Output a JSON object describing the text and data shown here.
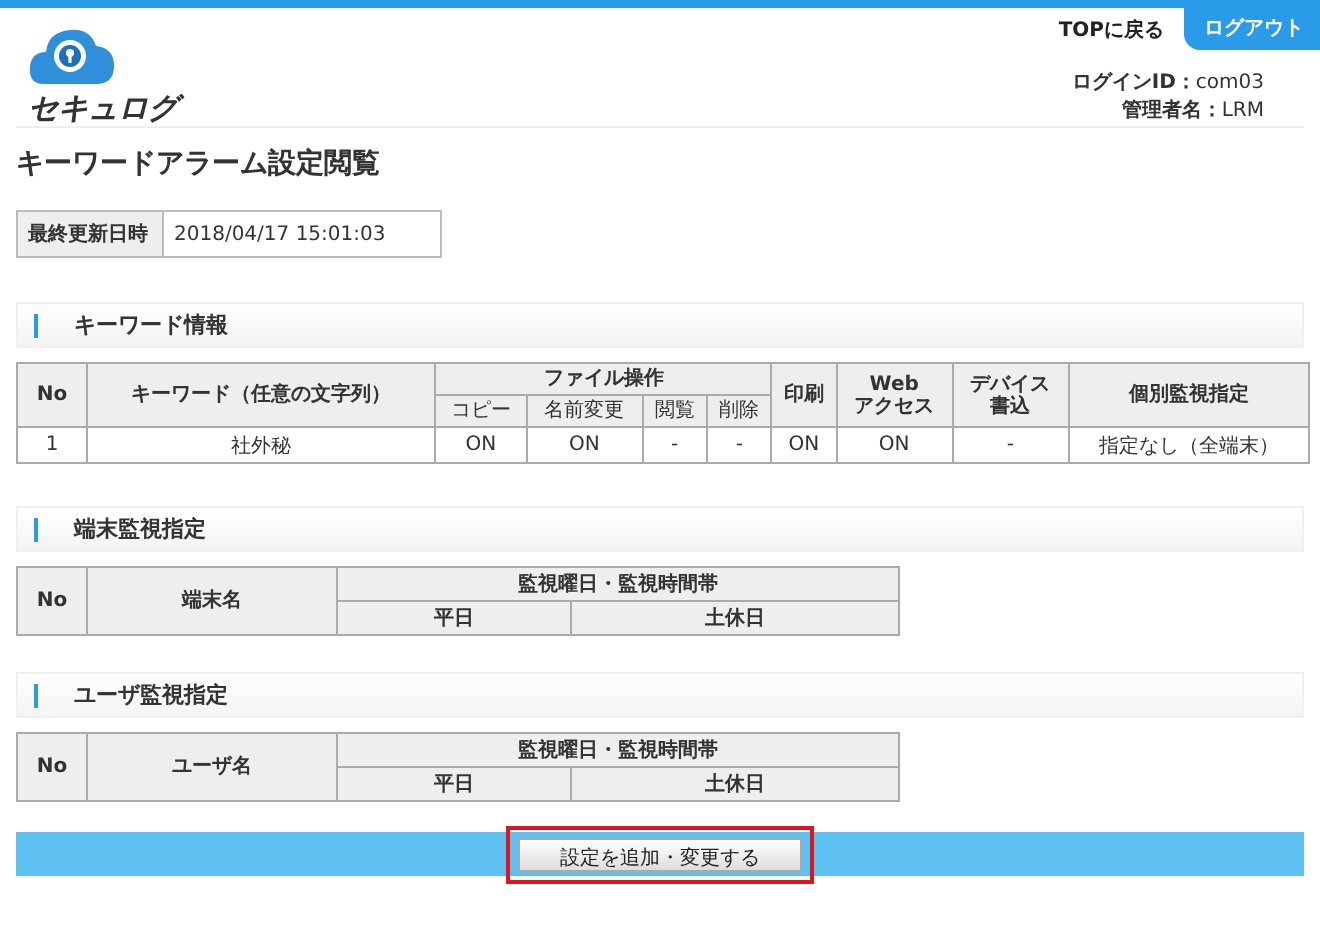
{
  "header": {
    "logo_text": "セキュログ",
    "top_link": "TOPに戻る",
    "logout_button": "ログアウト",
    "login_id_label": "ログインID：",
    "login_id": "com03",
    "admin_label": "管理者名：",
    "admin": "LRM"
  },
  "page_title": "キーワードアラーム設定閲覧",
  "last_updated": {
    "label": "最終更新日時",
    "value": "2018/04/17 15:01:03"
  },
  "keyword_section": {
    "title": "キーワード情報",
    "table": {
      "header_rows": [
        [
          {
            "lines": [
              "No"
            ],
            "rowspan": 2
          },
          {
            "lines": [
              "キーワード（任意の文字列）"
            ],
            "rowspan": 2
          },
          {
            "lines": [
              "ファイル操作"
            ],
            "colspan": 4
          },
          {
            "lines": [
              "印刷"
            ],
            "rowspan": 2
          },
          {
            "lines": [
              "Web",
              "アクセス"
            ],
            "rowspan": 2
          },
          {
            "lines": [
              "デバイス",
              "書込"
            ],
            "rowspan": 2
          },
          {
            "lines": [
              "個別監視指定"
            ],
            "rowspan": 2
          }
        ],
        [
          {
            "lines": [
              "コピー"
            ]
          },
          {
            "lines": [
              "名前変更"
            ]
          },
          {
            "lines": [
              "閲覧"
            ]
          },
          {
            "lines": [
              "削除"
            ]
          }
        ]
      ],
      "rows": [
        {
          "cells": [
            "1",
            "社外秘",
            "ON",
            "ON",
            "-",
            "-",
            "ON",
            "ON",
            "-",
            "指定なし（全端末）"
          ]
        }
      ]
    }
  },
  "terminal_section": {
    "title": "端末監視指定",
    "table": {
      "columns": [
        "No",
        "端末名",
        "監視曜日・監視時間帯"
      ],
      "sub_columns": [
        "平日",
        "土休日"
      ]
    }
  },
  "user_section": {
    "title": "ユーザ監視指定",
    "table": {
      "columns": [
        "No",
        "ユーザ名",
        "監視曜日・監視時間帯"
      ],
      "sub_columns": [
        "平日",
        "土休日"
      ]
    }
  },
  "footer": {
    "button": "設定を追加・変更する",
    "highlighted": true
  }
}
